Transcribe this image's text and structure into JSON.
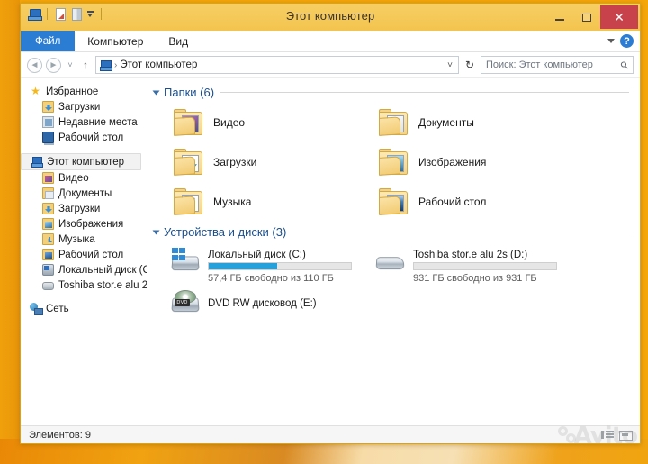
{
  "window": {
    "title": "Этот компьютер",
    "quick_access": [
      {
        "name": "this-pc-icon",
        "label": "Этот компьютер"
      },
      {
        "name": "new-document-icon",
        "label": "Создать"
      },
      {
        "name": "properties-icon",
        "label": "Свойства"
      },
      {
        "name": "customize-dropdown-icon",
        "label": "Настроить панель быстрого доступа"
      }
    ],
    "controls": {
      "minimize": "—",
      "maximize": "□",
      "close": "✕"
    }
  },
  "ribbon": {
    "tabs": [
      {
        "label": "Файл",
        "active": true
      },
      {
        "label": "Компьютер",
        "active": false
      },
      {
        "label": "Вид",
        "active": false
      }
    ],
    "collapse_icon": "chevron-down-icon",
    "help_label": "?"
  },
  "navigation": {
    "back_icon": "◄",
    "forward_icon": "►",
    "recent_icon": "˅",
    "up_icon": "↑",
    "address": {
      "icon": "this-pc-icon",
      "separator": "›",
      "text": "Этот компьютер",
      "dropdown_icon": "˅"
    },
    "refresh_icon": "↻",
    "search": {
      "placeholder": "Поиск: Этот компьютер",
      "value": "",
      "icon": "search-icon"
    }
  },
  "sidebar": {
    "sections": [
      {
        "header": {
          "label": "Избранное",
          "icon": "star-icon"
        },
        "items": [
          {
            "label": "Загрузки",
            "icon": "downloads-folder-icon"
          },
          {
            "label": "Недавние места",
            "icon": "recent-places-icon"
          },
          {
            "label": "Рабочий стол",
            "icon": "desktop-icon"
          }
        ]
      },
      {
        "header": {
          "label": "Этот компьютер",
          "icon": "this-pc-icon",
          "selected": true
        },
        "items": [
          {
            "label": "Видео",
            "icon": "videos-folder-icon"
          },
          {
            "label": "Документы",
            "icon": "documents-folder-icon"
          },
          {
            "label": "Загрузки",
            "icon": "downloads-folder-icon"
          },
          {
            "label": "Изображения",
            "icon": "pictures-folder-icon"
          },
          {
            "label": "Музыка",
            "icon": "music-folder-icon"
          },
          {
            "label": "Рабочий стол",
            "icon": "desktop-folder-icon"
          },
          {
            "label": "Локальный диск (C",
            "icon": "hard-drive-icon"
          },
          {
            "label": "Toshiba stor.e alu 2s",
            "icon": "external-drive-icon"
          }
        ]
      },
      {
        "header": {
          "label": "Сеть",
          "icon": "network-icon"
        },
        "items": []
      }
    ]
  },
  "content": {
    "groups": [
      {
        "label": "Папки (6)",
        "type": "folders",
        "items": [
          {
            "label": "Видео",
            "icon": "videos-folder-icon",
            "thumb": "video"
          },
          {
            "label": "Документы",
            "icon": "documents-folder-icon",
            "thumb": "docu"
          },
          {
            "label": "Загрузки",
            "icon": "downloads-folder-icon",
            "thumb": "dl"
          },
          {
            "label": "Изображения",
            "icon": "pictures-folder-icon",
            "thumb": "pics"
          },
          {
            "label": "Музыка",
            "icon": "music-folder-icon",
            "thumb": "mus"
          },
          {
            "label": "Рабочий стол",
            "icon": "desktop-folder-icon",
            "thumb": "desk"
          }
        ]
      },
      {
        "label": "Устройства и диски (3)",
        "type": "drives",
        "items": [
          {
            "name": "Локальный диск (C:)",
            "icon": "windows-system-drive-icon",
            "free_text": "57,4 ГБ свободно из 110 ГБ",
            "free_gb": 57.4,
            "total_gb": 110,
            "used_percent": 48,
            "bar_color": "#26A0DA",
            "has_bar": true
          },
          {
            "name": "Toshiba stor.e alu 2s (D:)",
            "icon": "external-drive-icon",
            "free_text": "931 ГБ свободно из 931 ГБ",
            "free_gb": 931,
            "total_gb": 931,
            "used_percent": 0,
            "bar_color": "#26A0DA",
            "has_bar": true
          },
          {
            "name": "DVD RW дисковод (E:)",
            "icon": "dvd-drive-icon",
            "free_text": "",
            "has_bar": false,
            "disc_label": "DVD"
          }
        ]
      }
    ]
  },
  "statusbar": {
    "items_text": "Элементов: 9",
    "view_buttons": [
      {
        "name": "details-view-button",
        "label": "Таблица"
      },
      {
        "name": "large-icons-view-button",
        "label": "Крупные значки"
      }
    ]
  },
  "watermark": {
    "text": "Avito"
  },
  "colors": {
    "frame": "#F3C553",
    "desktop": "#F5A609",
    "accent_blue": "#2B7CD3",
    "close_red": "#C7424A",
    "group_header": "#1B4F8C",
    "progress_blue": "#26A0DA"
  }
}
